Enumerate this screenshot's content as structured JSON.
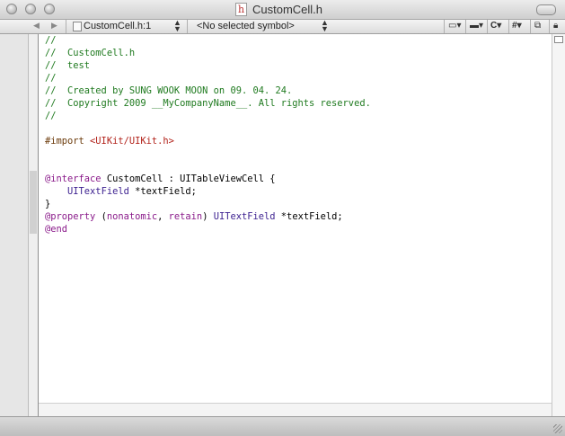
{
  "window": {
    "title": "CustomCell.h",
    "file_icon_glyph": "h"
  },
  "navbar": {
    "file_location": "CustomCell.h:1",
    "symbol_popup": "<No selected symbol>",
    "class_menu": "C",
    "pragma_menu": "#"
  },
  "editor": {
    "lines": [
      [
        {
          "t": "//",
          "c": "cm"
        }
      ],
      [
        {
          "t": "//  CustomCell.h",
          "c": "cm"
        }
      ],
      [
        {
          "t": "//  test",
          "c": "cm"
        }
      ],
      [
        {
          "t": "//",
          "c": "cm"
        }
      ],
      [
        {
          "t": "//  Created by SUNG WOOK MOON on 09. 04. 24.",
          "c": "cm"
        }
      ],
      [
        {
          "t": "//  Copyright 2009 __MyCompanyName__. All rights reserved.",
          "c": "cm"
        }
      ],
      [
        {
          "t": "//",
          "c": "cm"
        }
      ],
      [],
      [
        {
          "t": "#import ",
          "c": "pp"
        },
        {
          "t": "<UIKit/UIKit.h>",
          "c": "str"
        }
      ],
      [],
      [],
      [
        {
          "t": "@interface",
          "c": "kw"
        },
        {
          "t": " CustomCell : UITableViewCell {",
          "c": ""
        }
      ],
      [
        {
          "t": "    ",
          "c": ""
        },
        {
          "t": "UITextField",
          "c": "ty"
        },
        {
          "t": " *textField;",
          "c": ""
        }
      ],
      [
        {
          "t": "}",
          "c": ""
        }
      ],
      [
        {
          "t": "@property",
          "c": "kw"
        },
        {
          "t": " (",
          "c": ""
        },
        {
          "t": "nonatomic",
          "c": "kw"
        },
        {
          "t": ", ",
          "c": ""
        },
        {
          "t": "retain",
          "c": "kw"
        },
        {
          "t": ") ",
          "c": ""
        },
        {
          "t": "UITextField",
          "c": "ty"
        },
        {
          "t": " *textField;",
          "c": ""
        }
      ],
      [
        {
          "t": "@end",
          "c": "kw"
        }
      ]
    ]
  },
  "colors": {
    "comment": "#1f7a1f",
    "keyword": "#8a1a8a",
    "preprocessor": "#6b3a0a",
    "string": "#b2221a",
    "type": "#3b1f8f"
  },
  "icons": [
    "close-icon",
    "minimize-icon",
    "zoom-icon",
    "toolbar-toggle-icon",
    "back-arrow-icon",
    "forward-arrow-icon",
    "header-file-icon",
    "bookmarks-icon",
    "breakpoints-icon",
    "class-menu-icon",
    "pragma-menu-icon",
    "counterpart-icon",
    "lock-icon",
    "split-view-icon"
  ]
}
